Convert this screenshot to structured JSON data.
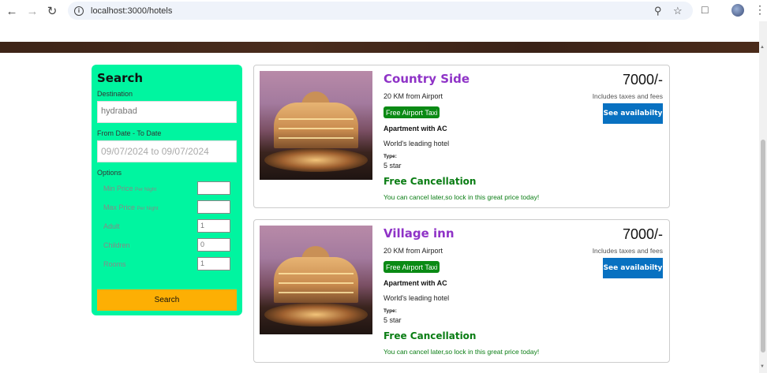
{
  "browser": {
    "url": "localhost:3000/hotels",
    "icons": [
      "back-icon",
      "forward-icon",
      "reload-icon",
      "info-icon",
      "key-icon",
      "star-icon",
      "extensions-icon",
      "avatar",
      "menu-icon"
    ]
  },
  "search": {
    "title": "Search",
    "destination_label": "Destination",
    "destination_value": "hydrabad",
    "date_label": "From Date - To Date",
    "date_value": "09/07/2024 to 09/07/2024",
    "options_label": "Options",
    "options": [
      {
        "label": "Min Price",
        "suffix": "Per Night",
        "value": ""
      },
      {
        "label": "Max Price",
        "suffix": "Per Night",
        "value": ""
      },
      {
        "label": "Adult",
        "suffix": "",
        "value": "1"
      },
      {
        "label": "Children",
        "suffix": "",
        "value": "0"
      },
      {
        "label": "Rooms",
        "suffix": "",
        "value": "1"
      }
    ],
    "button_label": "Search",
    "colors": {
      "panel": "#00f5a0",
      "button": "#fdaf04"
    }
  },
  "hotels": [
    {
      "name": "Country Side",
      "distance": "20 KM from Airport",
      "taxi": "Free Airport Taxi",
      "apartment": "Apartment with AC",
      "description": "World's leading hotel",
      "type_label": "Type:",
      "type_value": "5 star",
      "cancel_title": "Free Cancellation",
      "cancel_text": "You can cancel later,so lock in this great price today!",
      "price": "7000/-",
      "tax_note": "Includes taxes and fees",
      "availability_label": "See availabilty"
    },
    {
      "name": "Village inn",
      "distance": "20 KM from Airport",
      "taxi": "Free Airport Taxi",
      "apartment": "Apartment with AC",
      "description": "World's leading hotel",
      "type_label": "Type:",
      "type_value": "5 star",
      "cancel_title": "Free Cancellation",
      "cancel_text": "You can cancel later,so lock in this great price today!",
      "price": "7000/-",
      "tax_note": "Includes taxes and fees",
      "availability_label": "See availabilty"
    }
  ],
  "colors": {
    "hotel_name": "#8f33c7",
    "badge": "#0a8a14",
    "availability": "#0871c1"
  }
}
